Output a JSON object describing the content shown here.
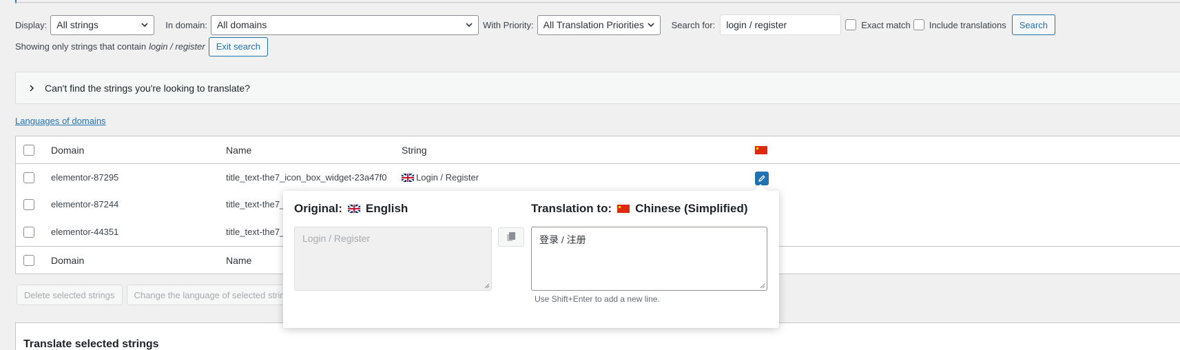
{
  "filters": {
    "display_label": "Display:",
    "display_value": "All strings",
    "domain_label": "In domain:",
    "domain_value": "All domains",
    "priority_label": "With Priority:",
    "priority_value": "All Translation Priorities",
    "search_label": "Search for:",
    "search_value": "login / register",
    "exact_match_label": "Exact match",
    "include_translations_label": "Include translations",
    "search_button": "Search"
  },
  "showing": {
    "prefix": "Showing only strings that contain",
    "term": "login / register",
    "exit_button": "Exit search"
  },
  "notice": {
    "text": "Can't find the strings you're looking to translate?"
  },
  "languages_link": "Languages of domains",
  "table": {
    "headers": {
      "domain": "Domain",
      "name": "Name",
      "string": "String"
    },
    "rows": [
      {
        "domain": "elementor-87295",
        "name": "title_text-the7_icon_box_widget-23a47f0",
        "string": "Login / Register"
      },
      {
        "domain": "elementor-87244",
        "name": "title_text-the7_",
        "string": ""
      },
      {
        "domain": "elementor-44351",
        "name": "title_text-the7_",
        "string": ""
      }
    ],
    "footers": {
      "domain": "Domain",
      "name": "Name"
    }
  },
  "bulk": {
    "delete": "Delete selected strings",
    "change_language": "Change the language of selected strin"
  },
  "translate_panel": {
    "title": "Translate selected strings"
  },
  "popup": {
    "original_label": "Original:",
    "original_language": "English",
    "translation_label": "Translation to:",
    "translation_language": "Chinese (Simplified)",
    "original_text": "Login / Register",
    "translation_text": "登录 / 注册",
    "hint": "Use Shift+Enter to add a new line."
  },
  "colors": {
    "accent": "#2271b1",
    "background": "#f0f0f1"
  }
}
